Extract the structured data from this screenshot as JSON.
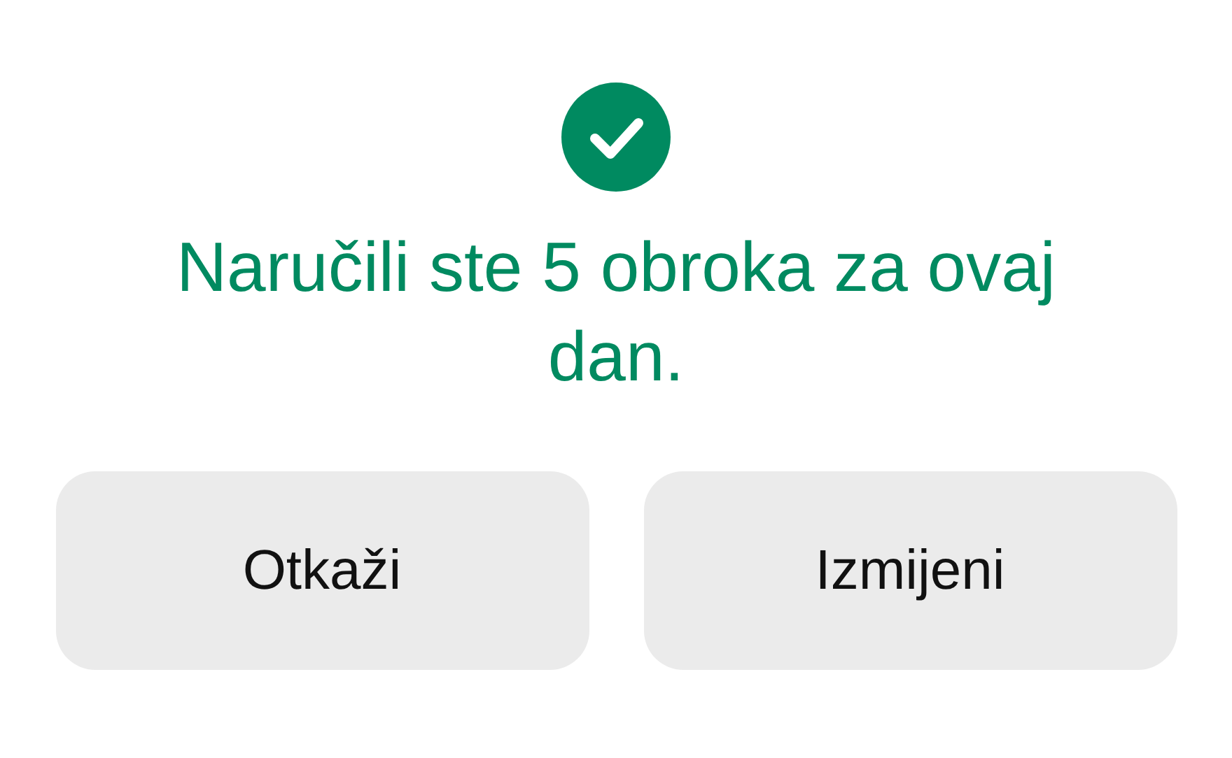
{
  "dialog": {
    "confirmed": true,
    "message": "Naručili ste 5 obroka za ovaj dan."
  },
  "buttons": [
    {
      "label": "Otkaži"
    },
    {
      "label": "Izmijeni"
    }
  ]
}
